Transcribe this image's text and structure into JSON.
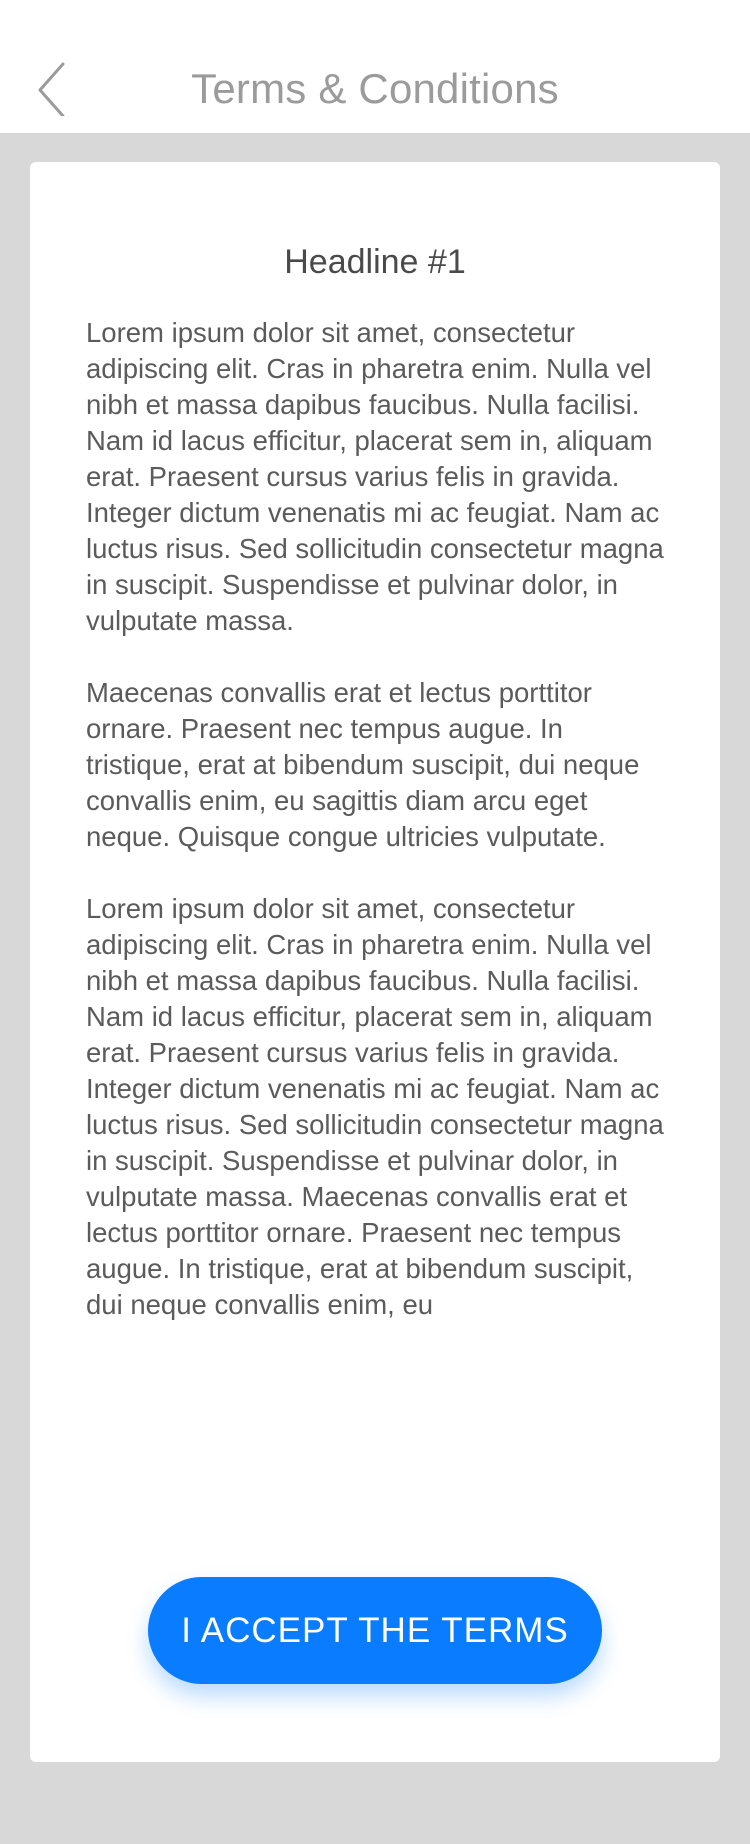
{
  "header": {
    "title": "Terms & Conditions",
    "back_icon": "chevron-left-icon"
  },
  "card": {
    "headline": "Headline #1",
    "paragraphs": [
      "Lorem ipsum dolor sit amet, consectetur adipiscing elit. Cras in pharetra enim. Nulla vel nibh et massa dapibus faucibus. Nulla facilisi. Nam id lacus efficitur, placerat sem in, aliquam erat. Praesent cursus varius felis in gravida. Integer dictum venenatis mi ac feugiat. Nam ac luctus risus. Sed sollicitudin consectetur magna in suscipit. Suspendisse et pulvinar dolor, in vulputate massa.",
      "Maecenas convallis erat et lectus porttitor ornare. Praesent nec tempus augue. In tristique, erat at bibendum suscipit, dui neque convallis enim, eu sagittis diam arcu eget neque. Quisque congue ultricies vulputate.",
      "Lorem ipsum dolor sit amet, consectetur adipiscing elit. Cras in pharetra enim. Nulla vel nibh et massa dapibus faucibus. Nulla facilisi. Nam id lacus efficitur, placerat sem in, aliquam erat. Praesent cursus varius felis in gravida. Integer dictum venenatis mi ac feugiat. Nam ac luctus risus. Sed sollicitudin consectetur magna in suscipit. Suspendisse et pulvinar dolor, in vulputate massa. Maecenas convallis erat et lectus porttitor ornare. Praesent nec tempus augue. In tristique, erat at bibendum suscipit, dui neque convallis enim, eu"
    ]
  },
  "actions": {
    "accept_label": "I ACCEPT THE TERMS"
  },
  "colors": {
    "background": "#d8d8d8",
    "accent": "#0a7cff",
    "title": "#9b9b9b",
    "body_text": "#5b5b5b"
  }
}
